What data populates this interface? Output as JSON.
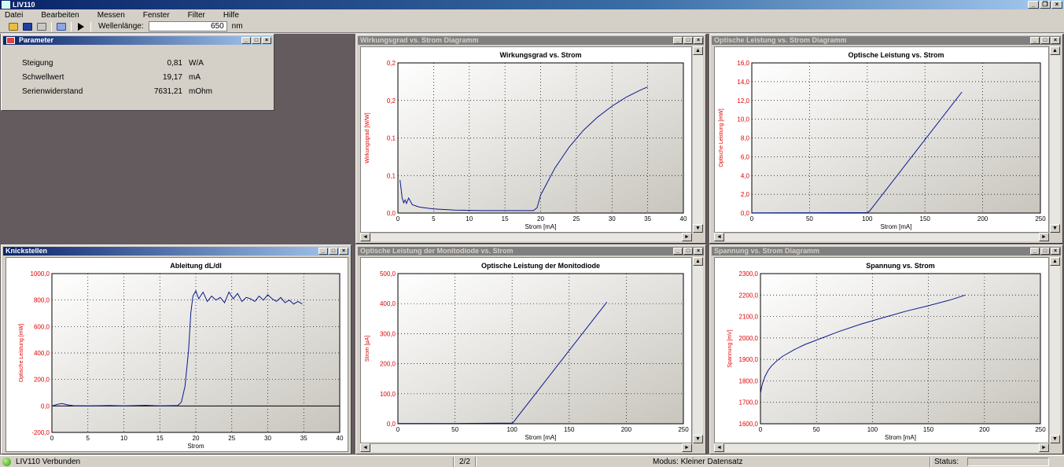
{
  "app": {
    "title": "LIV110"
  },
  "menu": [
    "Datei",
    "Bearbeiten",
    "Messen",
    "Fenster",
    "Filter",
    "Hilfe"
  ],
  "toolbar": {
    "wavelength_label": "Wellenlänge:",
    "wavelength_value": "650",
    "wavelength_unit": "nm"
  },
  "parameter": {
    "title": "Parameter",
    "rows": [
      {
        "label": "Steigung",
        "value": "0,81",
        "unit": "W/A"
      },
      {
        "label": "Schwellwert",
        "value": "19,17",
        "unit": "mA"
      },
      {
        "label": "Serienwiderstand",
        "value": "7631,21",
        "unit": "mOhm"
      }
    ]
  },
  "status": {
    "connection": "LIV110 Verbunden",
    "page": "2/2",
    "mode": "Modus: Kleiner Datensatz",
    "status_label": "Status:"
  },
  "colors": {
    "curve": "#0a1a8c",
    "axis_label": "#e00000",
    "title_active": "#0a246a",
    "mdi_bg": "#645b5e"
  },
  "chart_data": [
    {
      "window_title": "Wirkungsgrad vs. Strom Diagramm",
      "title": "Wirkungsgrad vs. Strom",
      "type": "line",
      "xlabel": "Strom [mA]",
      "ylabel": "Wirkungsgrad [W/W]",
      "xlim": [
        0,
        40
      ],
      "ylim": [
        0,
        0.25
      ],
      "xticks": [
        "0",
        "5",
        "10",
        "15",
        "20",
        "25",
        "30",
        "35",
        "40"
      ],
      "yticks": [
        "0,0",
        "0,1",
        "0,1",
        "0,2",
        "0,2"
      ],
      "grid": true,
      "x": [
        0.3,
        0.4,
        0.6,
        0.8,
        1.0,
        1.2,
        1.5,
        2,
        3,
        5,
        8,
        12,
        16,
        19,
        19.5,
        20,
        22,
        24,
        26,
        28,
        30,
        32,
        34,
        35
      ],
      "y": [
        0.055,
        0.045,
        0.025,
        0.017,
        0.022,
        0.016,
        0.025,
        0.014,
        0.01,
        0.007,
        0.005,
        0.004,
        0.004,
        0.004,
        0.009,
        0.03,
        0.075,
        0.11,
        0.138,
        0.16,
        0.178,
        0.193,
        0.205,
        0.21
      ]
    },
    {
      "window_title": "Optische Leistung vs. Strom Diagramm",
      "title": "Optische Leistung vs. Strom",
      "type": "line",
      "xlabel": "Strom [mA]",
      "ylabel": "Optische Leistung [mW]",
      "xlim": [
        0,
        250
      ],
      "ylim": [
        0,
        16
      ],
      "xticks": [
        "0",
        "50",
        "100",
        "150",
        "200",
        "250"
      ],
      "yticks": [
        "0,0",
        "2,0",
        "4,0",
        "6,0",
        "8,0",
        "10,0",
        "12,0",
        "14,0",
        "16,0"
      ],
      "grid": true,
      "x": [
        0,
        50,
        100,
        102,
        182
      ],
      "y": [
        0.02,
        0.03,
        0.05,
        0.2,
        12.9
      ]
    },
    {
      "window_title": "Knickstellen",
      "title": "Ableitung dL/dI",
      "type": "line",
      "xlabel": "Strom",
      "ylabel": "Optische Leistung [mW]",
      "xlim": [
        0,
        40
      ],
      "ylim": [
        -200,
        1000
      ],
      "xticks": [
        "0",
        "5",
        "10",
        "15",
        "20",
        "25",
        "30",
        "35",
        "40"
      ],
      "yticks": [
        "-200,0",
        "0,0",
        "200,0",
        "400,0",
        "600,0",
        "800,0",
        "1000,0"
      ],
      "grid": true,
      "x": [
        0,
        0.8,
        1.4,
        2.2,
        3,
        5,
        8,
        10,
        13,
        15,
        17.5,
        18,
        18.5,
        19,
        19.3,
        19.6,
        20,
        20.4,
        21,
        21.6,
        22.2,
        22.8,
        23.4,
        24,
        24.6,
        25.2,
        25.8,
        26.4,
        27,
        27.6,
        28.2,
        28.8,
        29.4,
        30,
        30.6,
        31.2,
        31.8,
        32.4,
        33,
        33.6,
        34.2,
        34.8
      ],
      "y": [
        0,
        12,
        18,
        8,
        2,
        0,
        3,
        1,
        5,
        0,
        4,
        30,
        150,
        420,
        700,
        830,
        870,
        810,
        860,
        790,
        830,
        800,
        820,
        780,
        860,
        810,
        850,
        790,
        820,
        810,
        790,
        830,
        800,
        840,
        810,
        790,
        820,
        780,
        800,
        770,
        790,
        770
      ]
    },
    {
      "window_title": "Optische Leistung der Monitodiode vs. Strom",
      "title": "Optische Leistung der Monitodiode",
      "type": "line",
      "xlabel": "Strom [mA]",
      "ylabel": "Strom [µA]",
      "xlim": [
        0,
        250
      ],
      "ylim": [
        0,
        500
      ],
      "xticks": [
        "0",
        "50",
        "100",
        "150",
        "200",
        "250"
      ],
      "yticks": [
        "0,0",
        "100,0",
        "200,0",
        "300,0",
        "400,0",
        "500,0"
      ],
      "grid": true,
      "x": [
        0,
        50,
        100,
        101,
        183
      ],
      "y": [
        1,
        1,
        2,
        5,
        405
      ]
    },
    {
      "window_title": "Spannung vs. Strom Diagramm",
      "title": "Spannung vs. Strom",
      "type": "line",
      "xlabel": "Strom [mA]",
      "ylabel": "Spannung [mV]",
      "xlim": [
        0,
        250
      ],
      "ylim": [
        1600,
        2300
      ],
      "xticks": [
        "0",
        "50",
        "100",
        "150",
        "200",
        "250"
      ],
      "yticks": [
        "1600,0",
        "1700,0",
        "1800,0",
        "1900,0",
        "2000,0",
        "2100,0",
        "2200,0",
        "2300,0"
      ],
      "grid": true,
      "x": [
        0,
        1,
        2,
        4,
        7,
        10,
        15,
        20,
        30,
        40,
        50,
        70,
        90,
        110,
        130,
        150,
        170,
        183
      ],
      "y": [
        1740,
        1770,
        1790,
        1820,
        1850,
        1870,
        1895,
        1915,
        1945,
        1970,
        1990,
        2030,
        2065,
        2095,
        2125,
        2150,
        2178,
        2200
      ]
    }
  ]
}
